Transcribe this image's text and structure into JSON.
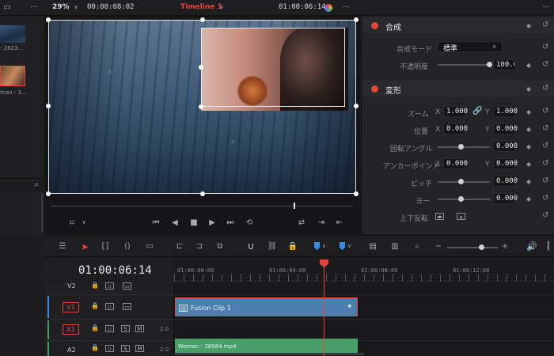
{
  "viewer": {
    "zoom": "29%",
    "source_timecode": "00:00:08:02",
    "timeline_name": "Timeline 1",
    "record_timecode": "01:00:06:14"
  },
  "media_pool": {
    "clips": [
      {
        "label": "- 2823..."
      },
      {
        "label": "man - 3..."
      }
    ]
  },
  "inspector": {
    "composite": {
      "section_title": "合成",
      "mode_label": "合成モード",
      "mode_value": "標準",
      "opacity_label": "不透明度",
      "opacity_value": "100.00"
    },
    "transform": {
      "section_title": "変形",
      "zoom_label": "ズーム",
      "zoom_x": "1.000",
      "zoom_y": "1.000",
      "position_label": "位置",
      "position_x": "0.000",
      "position_y": "0.000",
      "rotation_label": "回転アングル",
      "rotation_value": "0.000",
      "anchor_label": "アンカーポイント",
      "anchor_x": "0.000",
      "anchor_y": "0.000",
      "pitch_label": "ピッチ",
      "pitch_value": "0.000",
      "yaw_label": "ヨー",
      "yaw_value": "0.000",
      "flip_label": "上下反転",
      "x_letter": "X",
      "y_letter": "Y"
    }
  },
  "timeline": {
    "timecode": "01:00:06:14",
    "ruler": [
      "01:00:00:00",
      "01:00:04:00",
      "01:00:08:00",
      "01:00:12:00"
    ],
    "tracks": [
      {
        "id": "V2"
      },
      {
        "id": "V1"
      },
      {
        "id": "A1",
        "level": "2.0"
      },
      {
        "id": "A2",
        "level": "2.0"
      }
    ],
    "fusion_clip_label": "Fusion Clip 1",
    "audio_clip_label": "Woman - 38084.mp4",
    "solo_letter": "S",
    "mute_letter": "M"
  },
  "colors": {
    "accent_red": "#e5443b",
    "clip_blue": "#4a7fb0",
    "clip_green": "#4a9e6a",
    "playhead": "#e5443b"
  }
}
